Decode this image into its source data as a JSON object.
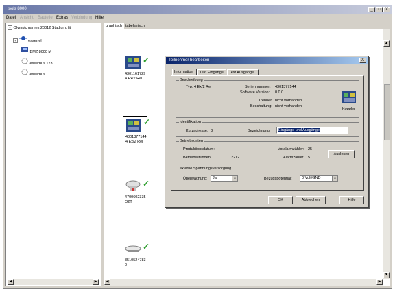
{
  "app": {
    "title": "tools 8000",
    "controls": {
      "minimize": "_",
      "maximize": "□",
      "close": "X"
    }
  },
  "menu": [
    "Datei",
    "Ansicht",
    "Bauteile",
    "Extras",
    "Verbindung",
    "Hilfe"
  ],
  "tree": {
    "root": "Olympic games 20012 Stadium, fit",
    "children": [
      "esserrel",
      "BMZ 8000 M",
      "esserbus 123",
      "esserbus"
    ]
  },
  "view_tabs": [
    "graphisch",
    "tabellarisch"
  ],
  "devices": [
    {
      "id": "4301161729",
      "desc": "4 Ex/2 Rel"
    },
    {
      "id": "4301377144",
      "desc": "4 Ex/2 Rel"
    },
    {
      "id": "4700602335",
      "desc": "O2T"
    },
    {
      "id": "3510524783",
      "desc": "0"
    }
  ],
  "dialog": {
    "title": "Teilnehmer bearbeiten",
    "close": "X",
    "tabs": [
      "Information",
      "Text Eingänge",
      "Text Ausgänge"
    ],
    "beschreibung": {
      "label": "Beschreibung",
      "typ_label": "Typ:",
      "typ_value": "4 Ex/2 Rel",
      "serien_label": "Seriennummer:",
      "serien_value": "4301377144",
      "software_label": "Software Version:",
      "software_value": "0.0.0",
      "trenner_label": "Trenner:",
      "trenner_value": "nicht vorhanden",
      "beschaltung_label": "Beschaltung:",
      "beschaltung_value": "nicht vorhanden",
      "image_label": "Koppler"
    },
    "identifikation": {
      "label": "Identifikation",
      "kurz_label": "Kurzadresse:",
      "kurz_value": "3",
      "bez_label": "Bezeichnung:",
      "bez_value": "Eingänge und Ausgänge"
    },
    "betrieb": {
      "label": "Betriebsdaten",
      "prod_label": "Produktionsdatum:",
      "prod_value": "",
      "stunden_label": "Betriebsstunden:",
      "stunden_value": "2212",
      "vor_label": "Voralarmzähler:",
      "vor_value": "25",
      "alarm_label": "Alarmzähler:",
      "alarm_value": "5",
      "auslesen": "Auslesen"
    },
    "spannung": {
      "label": "externe Spannungsversorgung",
      "ueber_label": "Überwachung:",
      "ueber_value": "Ja",
      "bezug_label": "Bezugspotential:",
      "bezug_value": "0 Volt/GND"
    },
    "buttons": {
      "ok": "OK",
      "abbrechen": "Abbrechen",
      "hilfe": "Hilfe"
    }
  },
  "colors": {
    "selection": "#0a246a",
    "check": "#2e9e2e",
    "title_start": "#0a246a"
  }
}
